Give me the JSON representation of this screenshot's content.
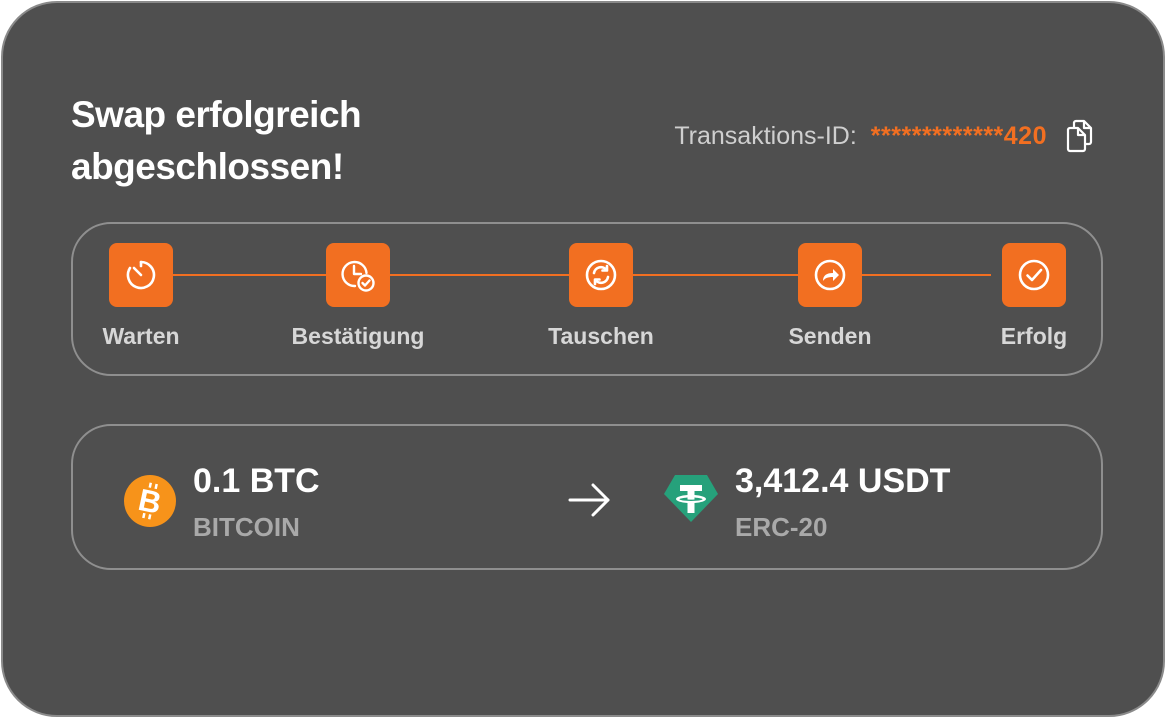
{
  "header": {
    "title": "Swap erfolgreich abgeschlossen!",
    "transaction_label": "Transaktions-ID:",
    "transaction_id": "*************420"
  },
  "steps": [
    {
      "label": "Warten",
      "icon": "timer-icon"
    },
    {
      "label": "Bestätigung",
      "icon": "clock-check-icon"
    },
    {
      "label": "Tauschen",
      "icon": "refresh-icon"
    },
    {
      "label": "Senden",
      "icon": "share-arrow-icon"
    },
    {
      "label": "Erfolg",
      "icon": "check-circle-icon"
    }
  ],
  "swap": {
    "from": {
      "amount": "0.1 BTC",
      "network": "BITCOIN",
      "icon": "bitcoin-icon",
      "color": "#f7931a"
    },
    "to": {
      "amount": "3,412.4 USDT",
      "network": "ERC-20",
      "icon": "tether-icon",
      "color": "#26a17b"
    }
  },
  "colors": {
    "accent": "#f26f21",
    "background": "#4f4f4f",
    "border": "#8f8f8f"
  }
}
